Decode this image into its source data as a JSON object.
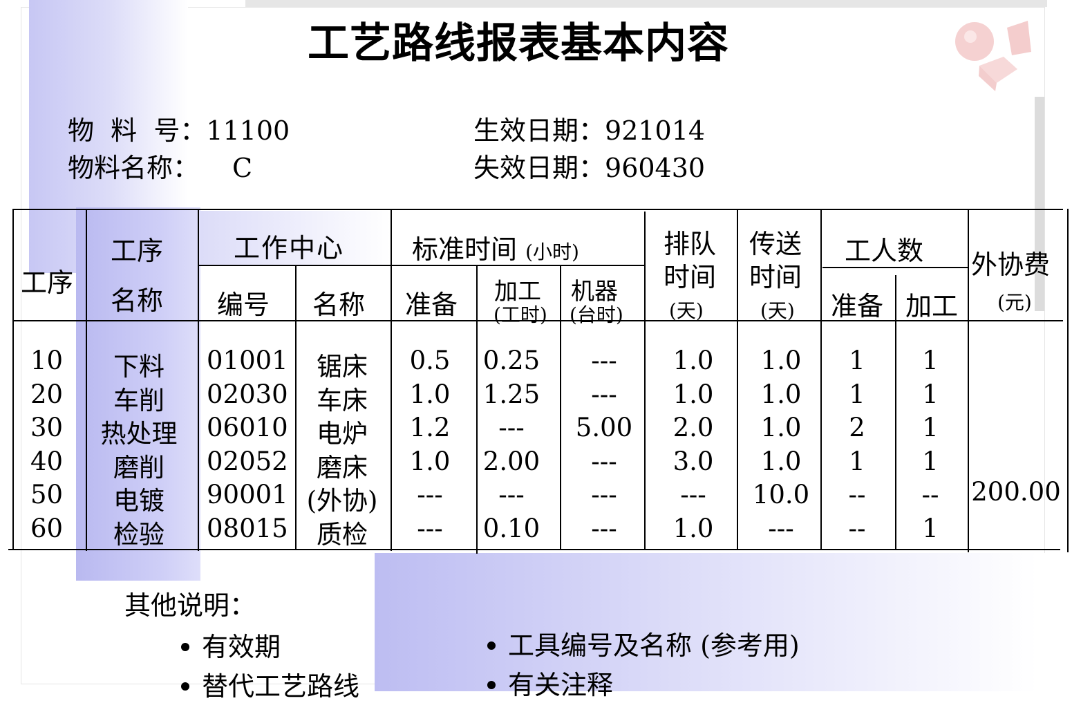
{
  "title": "工艺路线报表基本内容",
  "info": {
    "material_no_label": "物  料  号：",
    "material_no": "11100",
    "material_name_label": "物料名称：",
    "material_name": "C",
    "effective_label": "生效日期：",
    "effective_date": "921014",
    "expire_label": "失效日期：",
    "expire_date": "960430"
  },
  "table": {
    "headers": {
      "op": "工序",
      "op_name_1": "工序",
      "op_name_2": "名称",
      "wc": "工作中心",
      "wc_code": "编号",
      "wc_name": "名称",
      "std_time": "标准时间",
      "std_time_unit": "(小时)",
      "prep": "准备",
      "process": "加工",
      "process_unit": "(工时)",
      "machine": "机器",
      "machine_unit": "(台时)",
      "queue_1": "排队",
      "queue_2": "时间",
      "queue_unit": "(天)",
      "transfer_1": "传送",
      "transfer_2": "时间",
      "transfer_unit": "(天)",
      "workers": "工人数",
      "workers_prep": "准备",
      "workers_process": "加工",
      "outsource": "外协费",
      "outsource_unit": "(元)"
    },
    "rows": [
      {
        "op": "10",
        "name": "下料",
        "code": "01001",
        "center": "锯床",
        "prep": "0.5",
        "process": "0.25",
        "machine": "---",
        "queue": "1.0",
        "transfer": "1.0",
        "w_prep": "1",
        "w_proc": "1",
        "fee": ""
      },
      {
        "op": "20",
        "name": "车削",
        "code": "02030",
        "center": "车床",
        "prep": "1.0",
        "process": "1.25",
        "machine": "---",
        "queue": "1.0",
        "transfer": "1.0",
        "w_prep": "1",
        "w_proc": "1",
        "fee": ""
      },
      {
        "op": "30",
        "name": "热处理",
        "code": "06010",
        "center": "电炉",
        "prep": "1.2",
        "process": "---",
        "machine": "5.00",
        "queue": "2.0",
        "transfer": "1.0",
        "w_prep": "2",
        "w_proc": "1",
        "fee": ""
      },
      {
        "op": "40",
        "name": "磨削",
        "code": "02052",
        "center": "磨床",
        "prep": "1.0",
        "process": "2.00",
        "machine": "---",
        "queue": "3.0",
        "transfer": "1.0",
        "w_prep": "1",
        "w_proc": "1",
        "fee": ""
      },
      {
        "op": "50",
        "name": "电镀",
        "code": "90001",
        "center": "(外协)",
        "prep": "---",
        "process": "---",
        "machine": "---",
        "queue": "---",
        "transfer": "10.0",
        "w_prep": "--",
        "w_proc": "--",
        "fee": "200.00"
      },
      {
        "op": "60",
        "name": "检验",
        "code": "08015",
        "center": "质检",
        "prep": "---",
        "process": "0.10",
        "machine": "---",
        "queue": "1.0",
        "transfer": "---",
        "w_prep": "--",
        "w_proc": "1",
        "fee": ""
      }
    ]
  },
  "notes": {
    "label": "其他说明：",
    "items": [
      "有效期",
      "工具编号及名称 (参考用)",
      "替代工艺路线",
      "有关注释"
    ]
  }
}
